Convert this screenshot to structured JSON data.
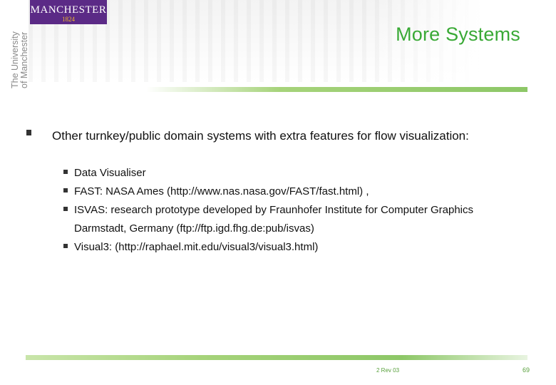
{
  "logo": {
    "name": "MANCHESTER",
    "year": "1824"
  },
  "university": {
    "line1": "The University",
    "line2": "of Manchester"
  },
  "slide": {
    "title": "More Systems",
    "bullet": "Other turnkey/public domain systems with extra features for flow visualization:",
    "sub_items": [
      "Data Visualiser",
      "FAST: NASA Ames (http://www.nas.nasa.gov/FAST/fast.html) ,",
      "ISVAS: research prototype developed by Fraunhofer Institute for Computer Graphics Darmstadt, Germany (ftp://ftp.igd.fhg.de:pub/isvas)",
      "Visual3: (http://raphael.mit.edu/visual3/visual3.html)"
    ]
  },
  "footer": {
    "date": "2 Rev 03",
    "page": "69"
  },
  "colors": {
    "accent": "#39a935",
    "logo_bg": "#5b2a86",
    "logo_year": "#f1b82d",
    "divider": "#8dc767"
  }
}
